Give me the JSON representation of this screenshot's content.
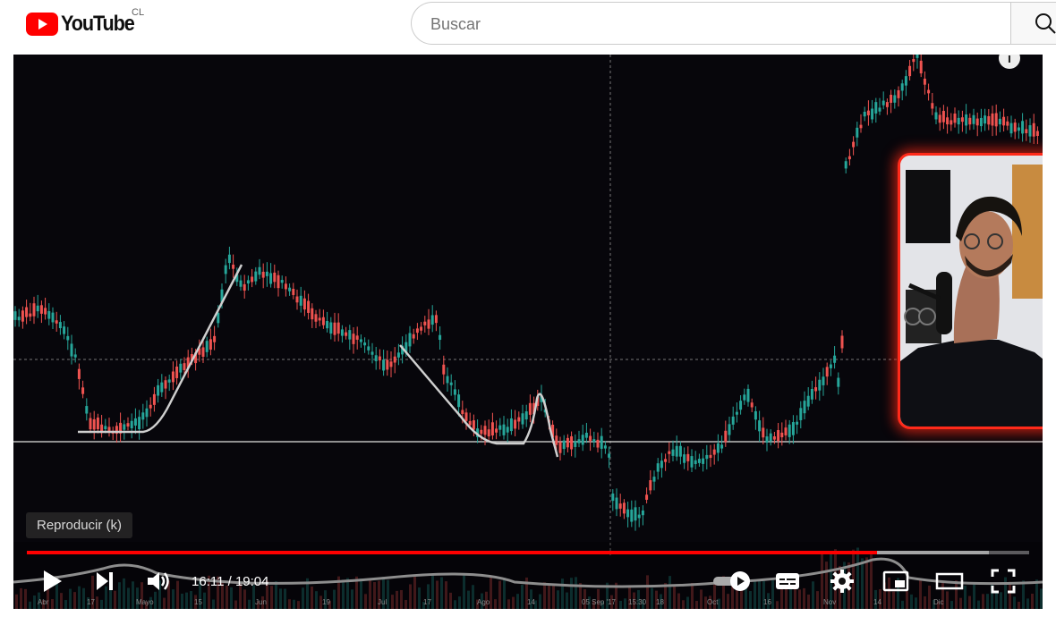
{
  "header": {
    "logo_text": "YouTube",
    "region": "CL",
    "search_placeholder": "Buscar"
  },
  "player": {
    "tooltip": "Reproducir (k)",
    "time_current": "16:11",
    "time_total": "19:04",
    "progress": 0.848,
    "buffered": 0.96,
    "chart_axis_labels": [
      "Abr",
      "17",
      "Mayo",
      "15",
      "Jun",
      "19",
      "Jul",
      "17",
      "Ago",
      "14",
      "05 Sep '17",
      "15:30",
      "18",
      "Oct",
      "16",
      "Nov",
      "14",
      "Dic"
    ],
    "colors": {
      "progress": "#ff0000",
      "bull": "#26a69a",
      "bear": "#ef5350",
      "cam_border": "#ff2a1a"
    }
  },
  "controls": {
    "icons": [
      "play-icon",
      "next-icon",
      "volume-icon",
      "autoplay-toggle",
      "subtitles-icon",
      "settings-icon",
      "miniplayer-icon",
      "theater-icon",
      "fullscreen-icon"
    ]
  }
}
